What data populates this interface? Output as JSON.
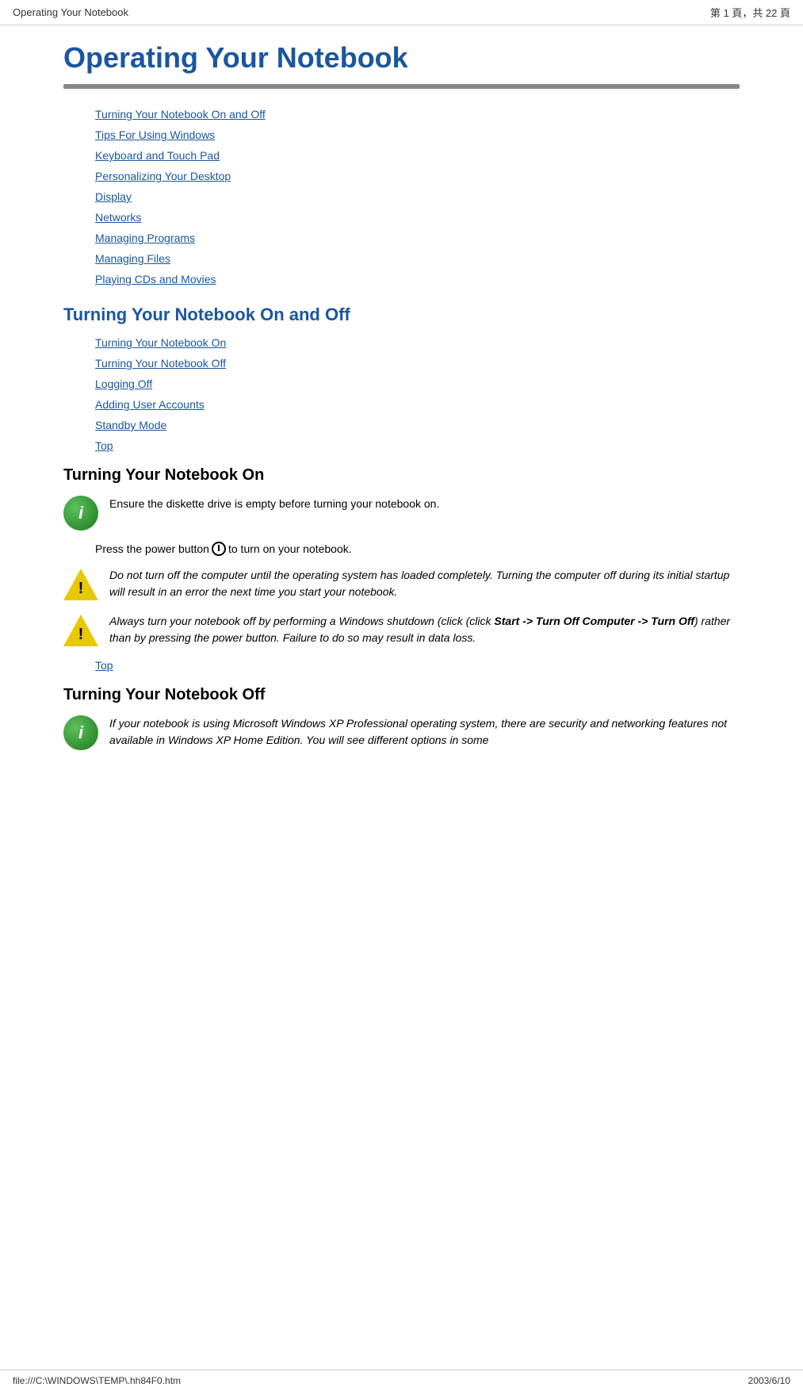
{
  "header": {
    "left": "Operating Your Notebook",
    "right": "第 1 頁，共 22 頁"
  },
  "footer": {
    "left": "file:///C:\\WINDOWS\\TEMP\\.hh84F0.htm",
    "right": "2003/6/10"
  },
  "page": {
    "title": "Operating Your Notebook",
    "toc_links": [
      "Turning Your Notebook On and Off",
      "Tips For Using Windows",
      "Keyboard and Touch Pad",
      "Personalizing Your Desktop",
      "Display",
      "Networks",
      "Managing Programs",
      "Managing Files",
      "Playing CDs and Movies"
    ],
    "section1": {
      "heading": "Turning Your Notebook On and Off",
      "links": [
        "Turning Your Notebook On",
        "Turning Your Notebook Off",
        "Logging Off",
        "Adding User Accounts",
        "Standby Mode",
        "Top"
      ]
    },
    "section2": {
      "heading": "Turning Your Notebook On",
      "note1": "Ensure the diskette drive is empty before turning your notebook on.",
      "press_text_before": "Press the power button",
      "press_text_after": "to turn on your notebook.",
      "warning1": "Do not turn off the computer until the operating system has loaded completely. Turning the computer off during its initial startup will result in an error the next time you start your notebook.",
      "warning2": "Always turn your notebook off by performing a Windows shutdown (click (click Start -> Turn Off Computer -> Turn Off) rather than by pressing the power button. Failure to do so may result in data loss.",
      "top_link": "Top"
    },
    "section3": {
      "heading": "Turning Your Notebook Off",
      "note1_italic": "If your notebook is using Microsoft Windows XP Professional operating system, there are security and networking features not available in Windows XP Home Edition. You will see different options in some"
    }
  }
}
